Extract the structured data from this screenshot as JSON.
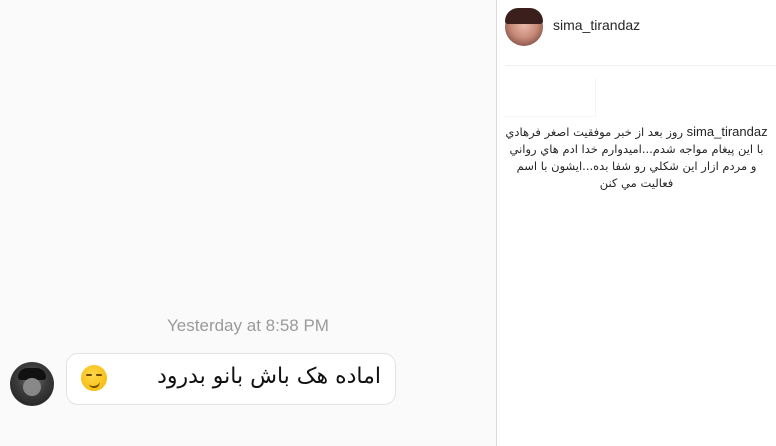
{
  "dm": {
    "timestamp": "Yesterday at 8:58 PM",
    "message": {
      "text": "اماده هک باش بانو بدرود",
      "emoji": "smirking-face-emoji"
    },
    "sender_avatar_icon": "sender-avatar"
  },
  "post": {
    "username": "sima_tirandaz",
    "caption_username": "sima_tirandaz",
    "caption_text": "روز بعد از خبر موفقيت اصغر فرهادي با اين پيغام مواجه شدم...اميدوارم خدا ادم هاي رواني و مردم ازار اين شكلي رو شفا بده...ايشون با اسم فعاليت مي كنن"
  },
  "colors": {
    "dm_background": "#fafafa",
    "timestamp": "#9a9a9a",
    "bubble_border": "#e3e3e3",
    "panel_border": "#dbdbdb"
  }
}
